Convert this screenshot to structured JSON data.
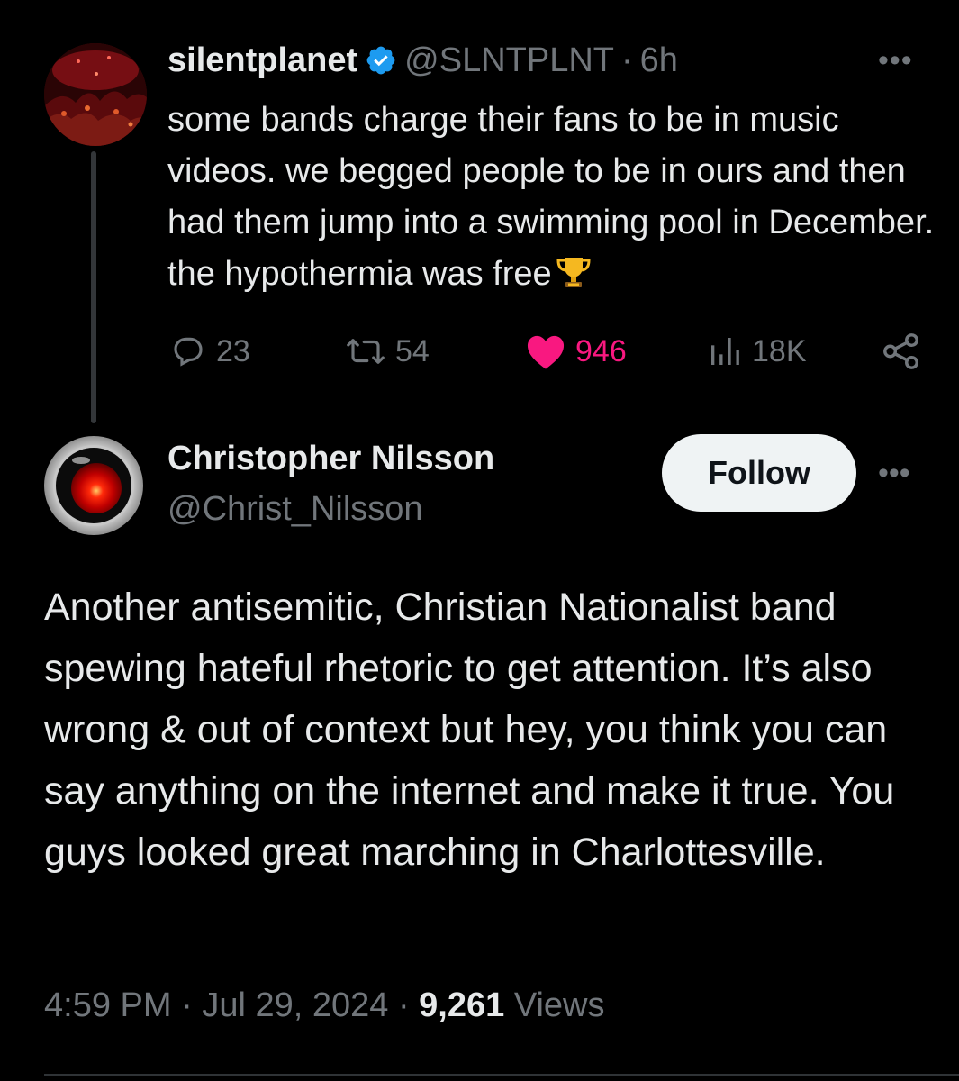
{
  "tweet": {
    "author_name": "silentplanet",
    "author_handle": "@SLNTPLNT",
    "separator": "·",
    "time_ago": "6h",
    "more_label": "•••",
    "text": "some bands charge their fans to be in music videos. we begged people to be in ours and then had them jump into a swimming pool in December. the hypothermia was free",
    "emoji_icon": "trophy-icon",
    "stats": {
      "replies": "23",
      "retweets": "54",
      "likes": "946",
      "views": "18K"
    }
  },
  "reply": {
    "author_name": "Christopher Nilsson",
    "author_handle": "@Christ_Nilsson",
    "follow_label": "Follow",
    "more_label": "•••",
    "text": "Another antisemitic, Christian Nationalist band spewing hateful rhetoric to get attention. It’s also wrong & out of context but hey, you think you can say anything on the internet and make it true. You guys looked great marching in Charlottesville.",
    "time": "4:59 PM",
    "separator": "·",
    "date": "Jul 29, 2024",
    "views_count": "9,261",
    "views_label": "Views"
  },
  "colors": {
    "background": "#000000",
    "text_primary": "#e7e9ea",
    "text_secondary": "#71767b",
    "like_pink": "#f91880",
    "verified_blue": "#1d9bf0",
    "follow_bg": "#eff3f4"
  }
}
